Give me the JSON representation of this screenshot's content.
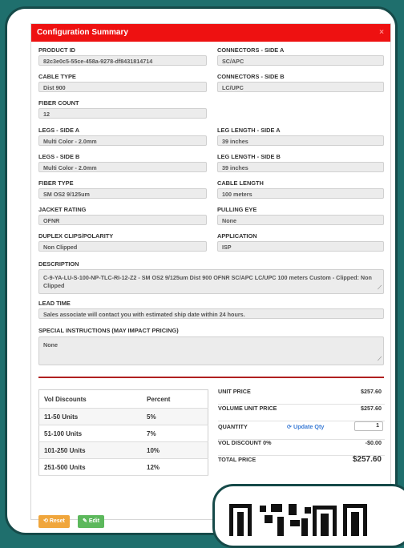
{
  "header": {
    "title": "Configuration Summary",
    "close": "×"
  },
  "fields": {
    "product_id": {
      "label": "PRODUCT ID",
      "value": "82c3e0c5-55ce-458a-9278-df8431814714"
    },
    "connectors_a": {
      "label": "CONNECTORS - SIDE A",
      "value": "SC/APC"
    },
    "cable_type": {
      "label": "CABLE TYPE",
      "value": "Dist 900"
    },
    "connectors_b": {
      "label": "CONNECTORS - SIDE B",
      "value": "LC/UPC"
    },
    "fiber_count": {
      "label": "FIBER COUNT",
      "value": "12"
    },
    "legs_a": {
      "label": "LEGS - SIDE A",
      "value": "Multi Color - 2.0mm"
    },
    "leg_length_a": {
      "label": "LEG LENGTH - SIDE A",
      "value": "39 inches"
    },
    "legs_b": {
      "label": "LEGS - SIDE B",
      "value": "Multi Color - 2.0mm"
    },
    "leg_length_b": {
      "label": "LEG LENGTH - SIDE B",
      "value": "39 inches"
    },
    "fiber_type": {
      "label": "FIBER TYPE",
      "value": "SM OS2 9/125um"
    },
    "cable_length": {
      "label": "CABLE LENGTH",
      "value": "100 meters"
    },
    "jacket_rating": {
      "label": "JACKET RATING",
      "value": "OFNR"
    },
    "pulling_eye": {
      "label": "PULLING EYE",
      "value": "None"
    },
    "duplex": {
      "label": "DUPLEX CLIPS/POLARITY",
      "value": "Non Clipped"
    },
    "application": {
      "label": "APPLICATION",
      "value": "ISP"
    }
  },
  "description": {
    "label": "DESCRIPTION",
    "value": "C-9-YA-LU-S-100-NP-TLC-RI-12-Z2 - SM OS2 9/125um Dist 900 OFNR SC/APC LC/UPC 100 meters  Custom - Clipped: Non Clipped"
  },
  "lead_time": {
    "label": "LEAD TIME",
    "value": "Sales associate will contact you with estimated ship date within 24 hours."
  },
  "special": {
    "label": "SPECIAL INSTRUCTIONS (MAY IMPACT PRICING)",
    "value": "None"
  },
  "discounts": {
    "headers": [
      "Vol Discounts",
      "Percent"
    ],
    "rows": [
      [
        "11-50 Units",
        "5%"
      ],
      [
        "51-100 Units",
        "7%"
      ],
      [
        "101-250 Units",
        "10%"
      ],
      [
        "251-500 Units",
        "12%"
      ]
    ]
  },
  "pricing": {
    "unit_price_label": "UNIT PRICE",
    "unit_price": "$257.60",
    "volume_label": "VOLUME UNIT PRICE",
    "volume_price": "$257.60",
    "quantity_label": "QUANTITY",
    "update_label": "Update Qty",
    "quantity": "1",
    "vol_discount_label": "VOL DISCOUNT 0%",
    "vol_discount": "-$0.00",
    "total_label": "TOTAL PRICE",
    "total": "$257.60"
  },
  "buttons": {
    "reset": "Reset",
    "edit": "Edit"
  },
  "colors": {
    "header": "#ee1111",
    "reset": "#f0a63c",
    "edit": "#5cb85c",
    "link": "#3a7bd5",
    "background": "#1f6f6d"
  },
  "icons": {
    "reset": "refresh-icon",
    "edit": "edit-icon",
    "update": "sync-icon"
  }
}
